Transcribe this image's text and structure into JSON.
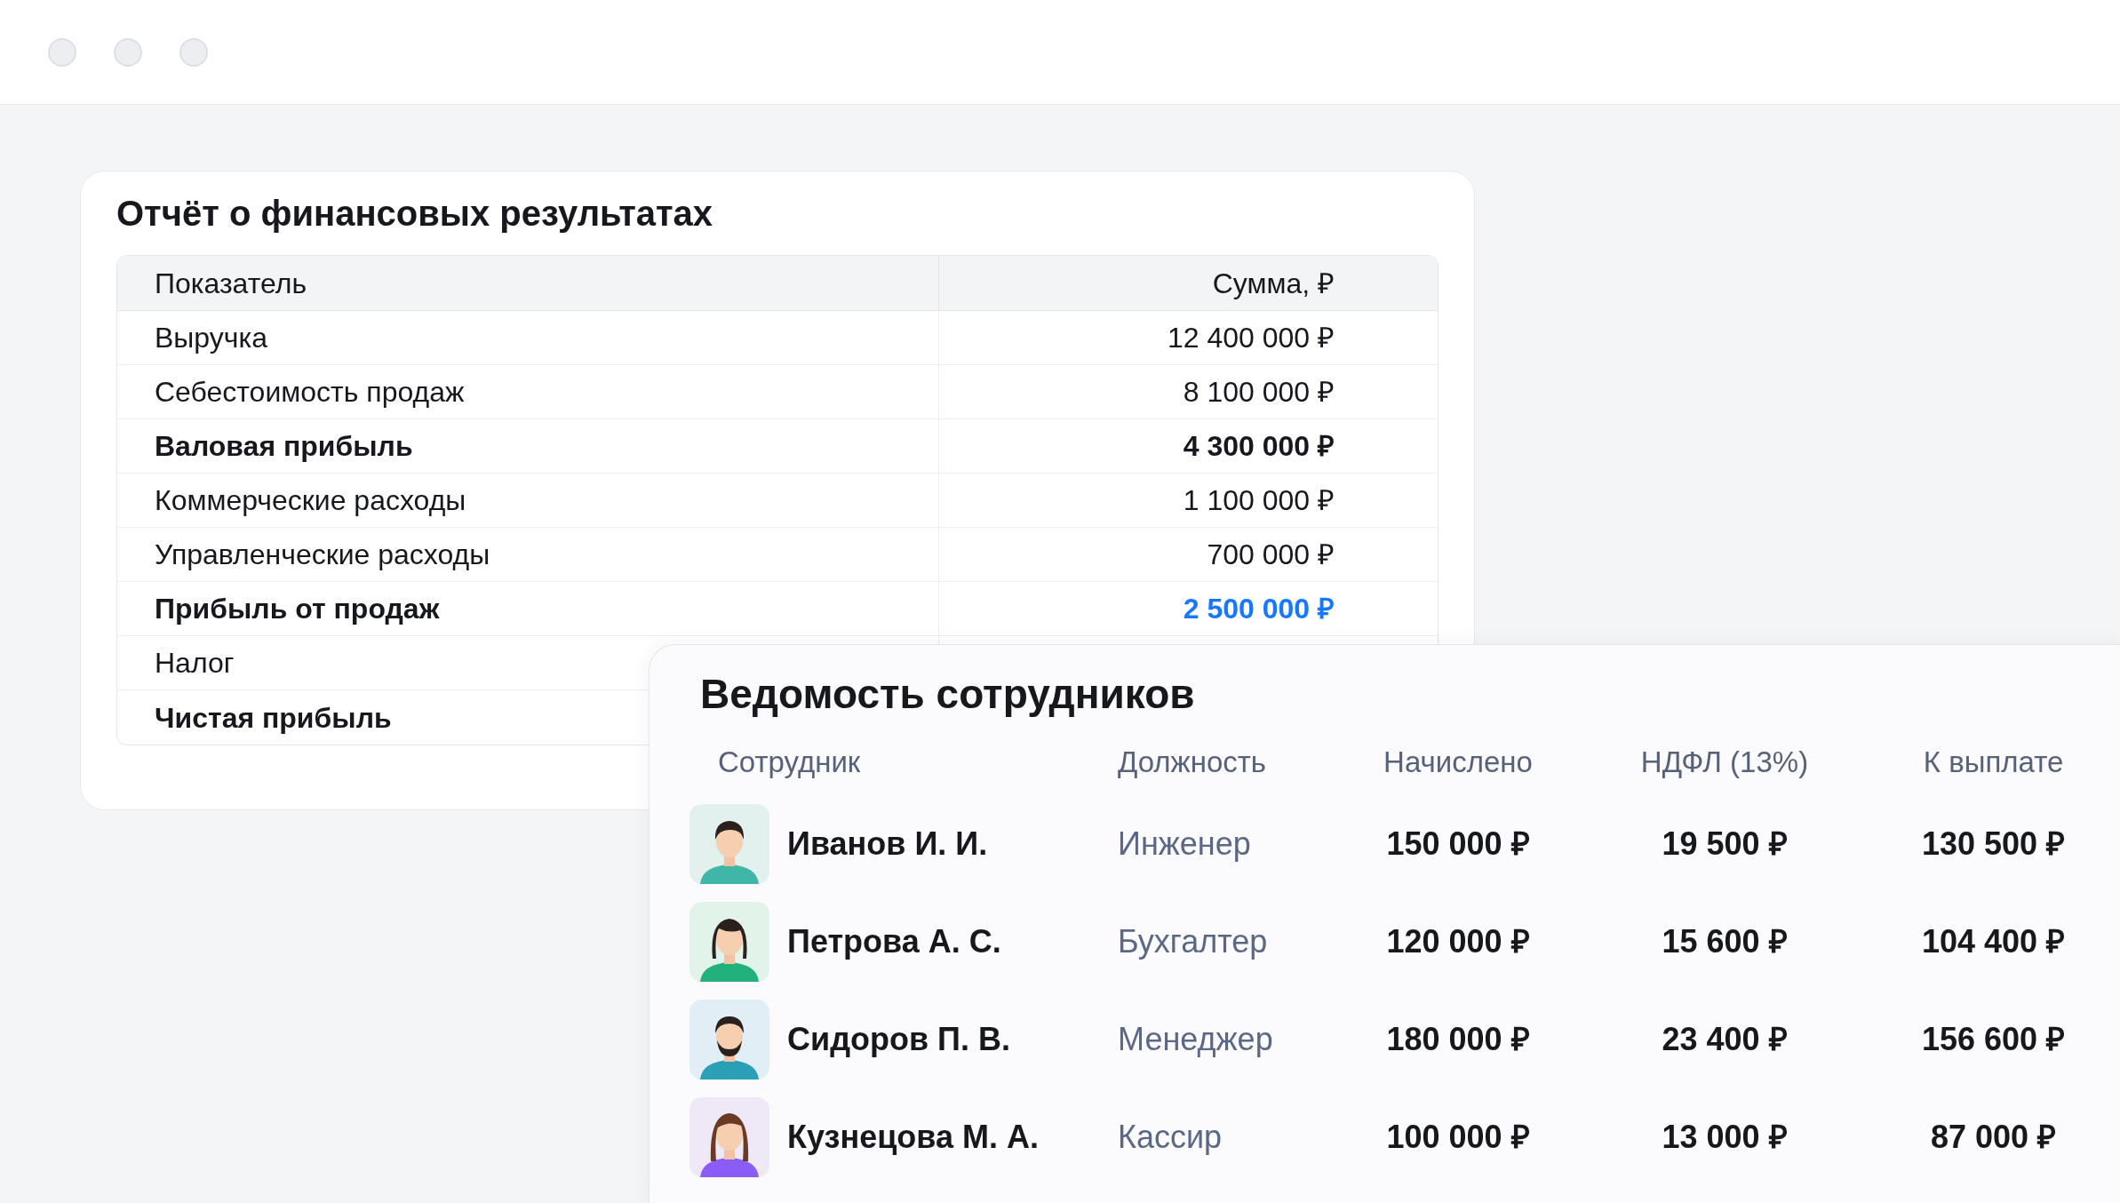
{
  "report": {
    "title": "Отчёт о финансовых результатах",
    "columns": [
      "Показатель",
      "Сумма, ₽"
    ],
    "rows": [
      {
        "kind": "normal",
        "label": "Выручка",
        "amount": "12 400 000 ₽"
      },
      {
        "kind": "normal",
        "label": "Себестоимость продаж",
        "amount": "8 100 000 ₽"
      },
      {
        "kind": "subtotal",
        "label": "Валовая прибыль",
        "amount": "4 300 000 ₽"
      },
      {
        "kind": "normal",
        "label": "Коммерческие расходы",
        "amount": "1 100 000 ₽"
      },
      {
        "kind": "normal",
        "label": "Управленческие расходы",
        "amount": "700 000 ₽"
      },
      {
        "kind": "key",
        "label": "Прибыль от продаж",
        "amount": "2 500 000 ₽"
      },
      {
        "kind": "normal",
        "label": "Налог"
      },
      {
        "kind": "subtotal",
        "label": "Чистая прибыль"
      }
    ]
  },
  "payroll": {
    "title": "Ведомость сотрудников",
    "columns": [
      "Сотрудник",
      "Должность",
      "Начислено",
      "НДФЛ (13%)",
      "К выплате"
    ],
    "rows": [
      {
        "avatar": {
          "kind": "male",
          "color": "#3fb6a8"
        },
        "name": "Иванов И. И.",
        "position": "Инженер",
        "accrued": "150 000 ₽",
        "tax": "19 500 ₽",
        "payout": "130 500 ₽"
      },
      {
        "avatar": {
          "kind": "female",
          "color": "#22b07d"
        },
        "name": "Петрова А. С.",
        "position": "Бухгалтер",
        "accrued": "120 000 ₽",
        "tax": "15 600 ₽",
        "payout": "104 400 ₽"
      },
      {
        "avatar": {
          "kind": "bearded",
          "color": "#2a9fb5"
        },
        "name": "Сидоров П. В.",
        "position": "Менеджер",
        "accrued": "180 000 ₽",
        "tax": "23 400 ₽",
        "payout": "156 600 ₽"
      },
      {
        "avatar": {
          "kind": "female_long",
          "color": "#8b5cf6"
        },
        "name": "Кузнецова М. А.",
        "position": "Кассир",
        "accrued": "100 000 ₽",
        "tax": "13 000 ₽",
        "payout": "87 000 ₽"
      }
    ]
  }
}
